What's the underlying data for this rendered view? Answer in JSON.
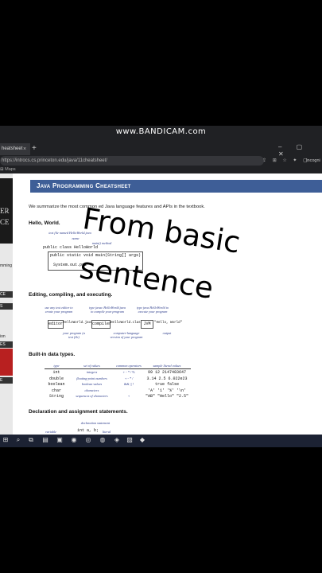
{
  "recorder": {
    "watermark": "www.BANDICAM.com"
  },
  "browser": {
    "tab_title": "heatsheet",
    "tab_close": "×",
    "new_tab": "+",
    "window_controls": "– ▢ ✕",
    "url": "https://introcs.cs.princeton.edu/java/11cheatsheet/",
    "toolbar_icons": "⇪ ⊞ ☆ ✦ ▢",
    "profile": "Incogni",
    "bookmarks": "⊞   Maps"
  },
  "sidebar": {
    "logo_lines": [
      "ER",
      "CE"
    ],
    "items": [
      "mming",
      "CE",
      "S",
      "ion",
      "ES",
      "E"
    ]
  },
  "page": {
    "banner": "Java Programming Cheatsheet",
    "intro": "We summarize the most common    ed Java language features and APIs in the textbook.",
    "sections": {
      "hello": "Hello, World.",
      "editing": "Editing, compiling, and executing.",
      "builtin": "Built-in data types.",
      "declaration": "Declaration and assignment statements."
    },
    "hello_notes": {
      "file": "text file named HelloWorld.java",
      "name": "name",
      "main": "main() method"
    },
    "hello_code": [
      "public class HelloWorld",
      "public static void main(String[] args)",
      "System.out.pri"
    ],
    "compile": {
      "editor": "editor",
      "compiler": "compiler",
      "jvm": "JVM",
      "src": "HelloWorld.java",
      "cls": "HelloWorld.class",
      "output": "\"Hello, World\"",
      "note1": "use any text editor to create your program",
      "note2": "type javac HelloWorld.java to compile your program",
      "note3": "type java HelloWorld to execute your program",
      "note4": "your program (a text file)",
      "note5": "computer-language version of your program",
      "note6": "output"
    },
    "types_table": {
      "headers": [
        "type",
        "set of values",
        "common operators",
        "sample literal values"
      ],
      "rows": [
        [
          "int",
          "integers",
          "+ - * / %",
          "99 12 2147483647"
        ],
        [
          "double",
          "floating-point numbers",
          "+ - * /",
          "3.14 2.5 6.022e23"
        ],
        [
          "boolean",
          "boolean values",
          "&& || !",
          "true false"
        ],
        [
          "char",
          "characters",
          "",
          "'A' '1' '%' '\\n'"
        ],
        [
          "String",
          "sequences of characters",
          "+",
          "\"AB\" \"Hello\" \"2.5\""
        ]
      ]
    },
    "decl_notes": {
      "declaration": "declaration statement",
      "variable": "variable name",
      "literal": "literal"
    },
    "decl_code": "int a, b;"
  },
  "overlay": {
    "line1": "From basic",
    "line2": "sentence"
  },
  "taskbar": {
    "icons": [
      "⊞",
      "⌕",
      "⧉",
      "▤",
      "▣",
      "◉",
      "◎",
      "◍",
      "◈",
      "▧",
      "◆"
    ]
  }
}
